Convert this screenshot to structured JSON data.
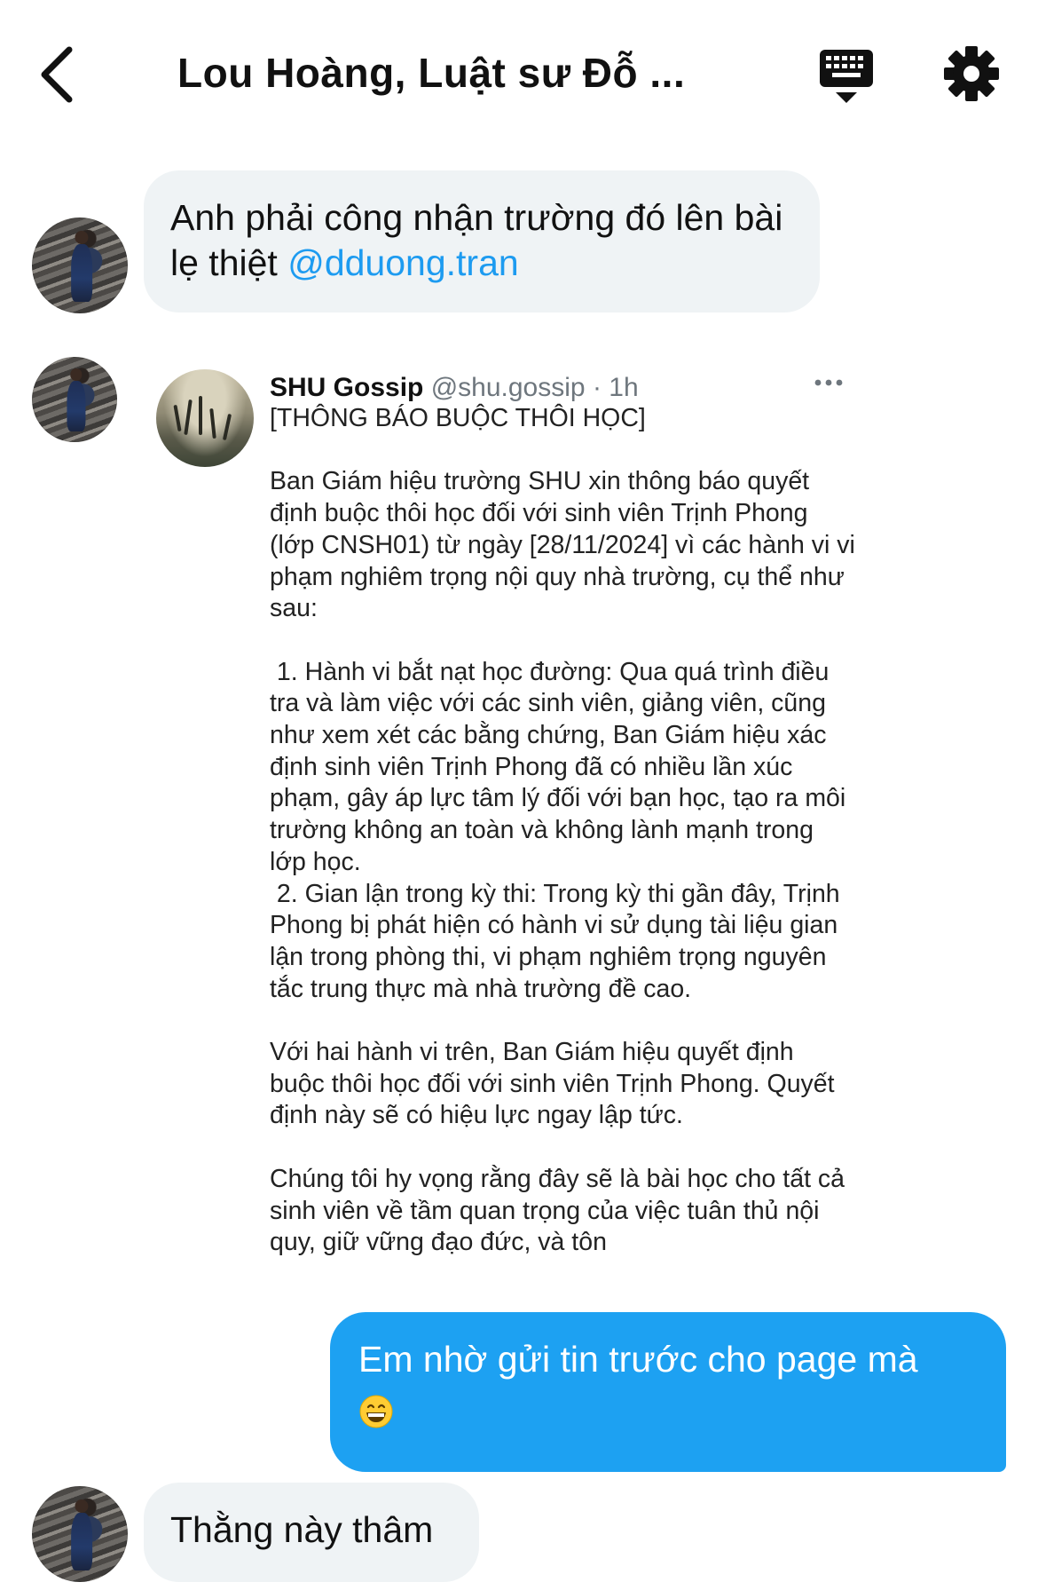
{
  "header": {
    "title": "Lou Hoàng, Luật sư Đỗ ...",
    "back_icon": "chevron-left-icon",
    "keyboard_icon": "keyboard-icon",
    "settings_icon": "gear-icon"
  },
  "messages": [
    {
      "sender": "other",
      "text": "Anh phải công nhận trường đó lên bài lẹ thiệt ",
      "mention": "@dduong.tran"
    },
    {
      "sender": "other",
      "type": "shared_tweet",
      "tweet": {
        "name": "SHU Gossip",
        "handle": "@shu.gossip",
        "time": "· 1h",
        "lines": [
          "[THÔNG BÁO BUỘC THÔI HỌC]",
          "",
          "Ban Giám hiệu trường SHU xin thông báo quyết định buộc thôi học đối với sinh viên Trịnh Phong (lớp CNSH01) từ ngày [28/11/2024] vì các hành vi vi phạm nghiêm trọng nội quy nhà trường, cụ thể như sau:",
          "",
          " 1. Hành vi bắt nạt học đường: Qua quá trình điều tra và làm việc với các sinh viên, giảng viên, cũng như xem xét các bằng chứng, Ban Giám hiệu xác định sinh viên Trịnh Phong đã có nhiều lần xúc phạm, gây áp lực tâm lý đối với bạn học, tạo ra môi trường không an toàn và không lành mạnh trong lớp học.",
          " 2. Gian lận trong kỳ thi: Trong kỳ thi gần đây, Trịnh Phong bị phát hiện có hành vi sử dụng tài liệu gian lận trong phòng thi, vi phạm nghiêm trọng nguyên tắc trung thực mà nhà trường đề cao.",
          "",
          "Với hai hành vi trên, Ban Giám hiệu quyết định buộc thôi học đối với sinh viên Trịnh Phong. Quyết định này sẽ có hiệu lực ngay lập tức.",
          "",
          "Chúng tôi hy vọng rằng đây sẽ là bài học cho tất cả sinh viên về tầm quan trọng của việc tuân thủ nội quy, giữ vững đạo đức, và tôn"
        ]
      }
    },
    {
      "sender": "me",
      "text": "Em nhờ gửi tin trước cho page mà",
      "emoji": "grinning-face-emoji"
    },
    {
      "sender": "other",
      "text": "Thằng này thâm"
    }
  ],
  "colors": {
    "accent": "#1da1f2",
    "mention": "#1d9bf0",
    "incoming_bubble": "#eff3f5",
    "handle_grey": "#6e767d"
  }
}
